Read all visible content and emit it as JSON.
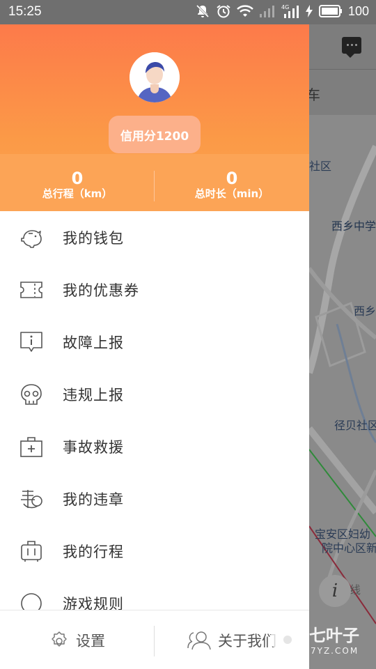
{
  "status_bar": {
    "time": "15:25",
    "battery": "100"
  },
  "profile": {
    "credit_label": "信用分1200"
  },
  "stats": [
    {
      "value": "0",
      "label": "总行程（km）"
    },
    {
      "value": "0",
      "label": "总时长（min）"
    }
  ],
  "menu": [
    {
      "label": "我的钱包",
      "icon": "wallet-icon"
    },
    {
      "label": "我的优惠券",
      "icon": "coupon-icon"
    },
    {
      "label": "故障上报",
      "icon": "fault-report-icon"
    },
    {
      "label": "违规上报",
      "icon": "skull-icon"
    },
    {
      "label": "事故救援",
      "icon": "first-aid-icon"
    },
    {
      "label": "我的违章",
      "icon": "violation-icon"
    },
    {
      "label": "我的行程",
      "icon": "luggage-icon"
    },
    {
      "label": "游戏规则",
      "icon": "rules-icon"
    }
  ],
  "footer": {
    "settings_label": "设置",
    "about_label": "关于我们"
  },
  "map": {
    "tab_text": "车",
    "labels": [
      "社区",
      "西乡中学",
      "西乡",
      "径贝社区",
      "宝安区妇幼",
      "院中心区新",
      "线"
    ]
  },
  "watermark": {
    "main": "七叶子",
    "sub": "7YZ.COM"
  },
  "colors": {
    "header_top": "#fd7a4a",
    "header_bottom": "#fca352",
    "overlay": "#777777"
  }
}
